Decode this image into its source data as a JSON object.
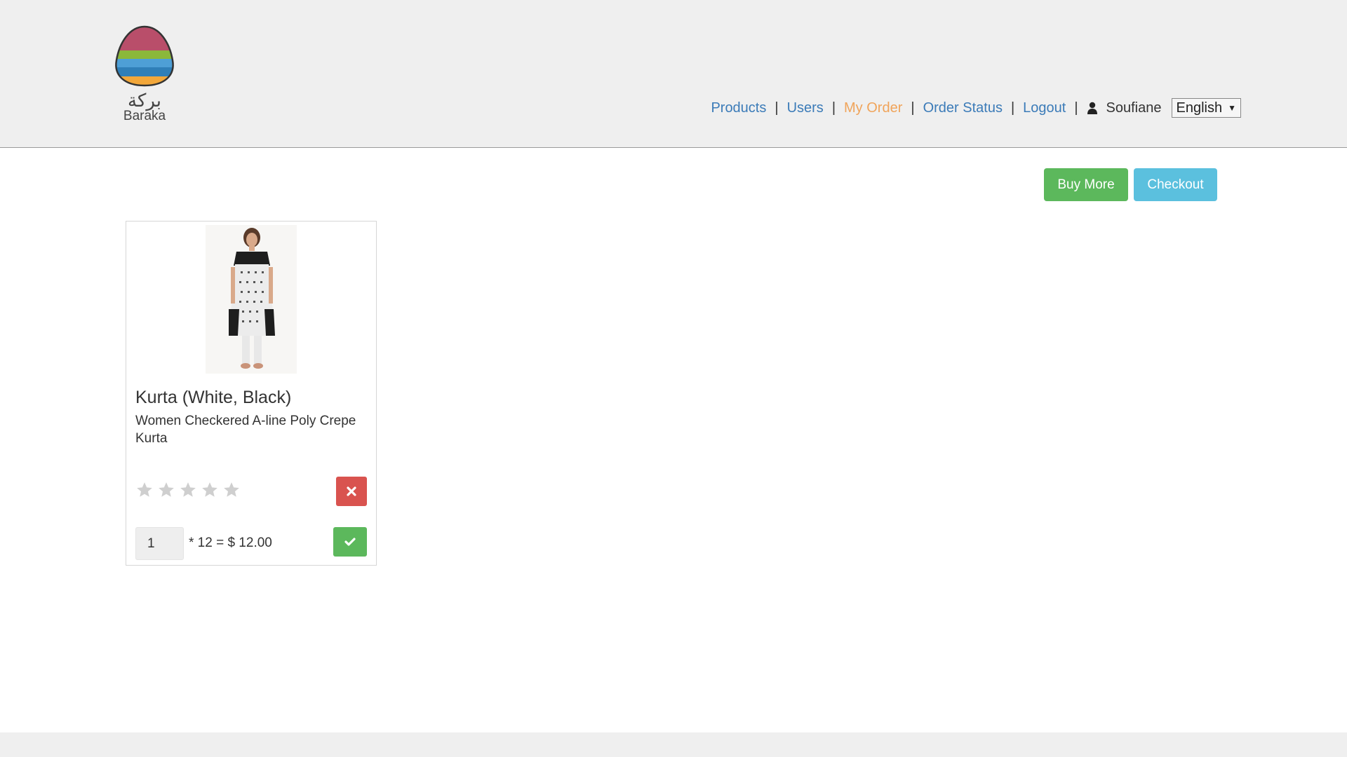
{
  "brand": {
    "name_ar": "بركة",
    "name_en": "Baraka"
  },
  "nav": {
    "items": [
      {
        "label": "Products"
      },
      {
        "label": "Users"
      },
      {
        "label": "My Order",
        "active": true
      },
      {
        "label": "Order Status"
      },
      {
        "label": "Logout"
      }
    ],
    "separator": "|",
    "user_icon": "user-icon",
    "username": "Soufiane",
    "language": "English",
    "language_caret": "▼"
  },
  "actions": {
    "buy_more_label": "Buy More",
    "checkout_label": "Checkout"
  },
  "order_items": [
    {
      "title": "Kurta (White, Black)",
      "description": "Women Checkered A-line Poly Crepe Kurta",
      "rating": 0,
      "rating_max": 5,
      "quantity": "1",
      "price_text": "* 12 = $ 12.00",
      "remove_icon": "close-icon",
      "confirm_icon": "check-icon"
    }
  ],
  "colors": {
    "link": "#3b7bb8",
    "active_link": "#f0a45a",
    "buy_more": "#5cb85c",
    "checkout": "#5bc0de",
    "remove": "#d9534f",
    "confirm": "#5cb85c"
  }
}
